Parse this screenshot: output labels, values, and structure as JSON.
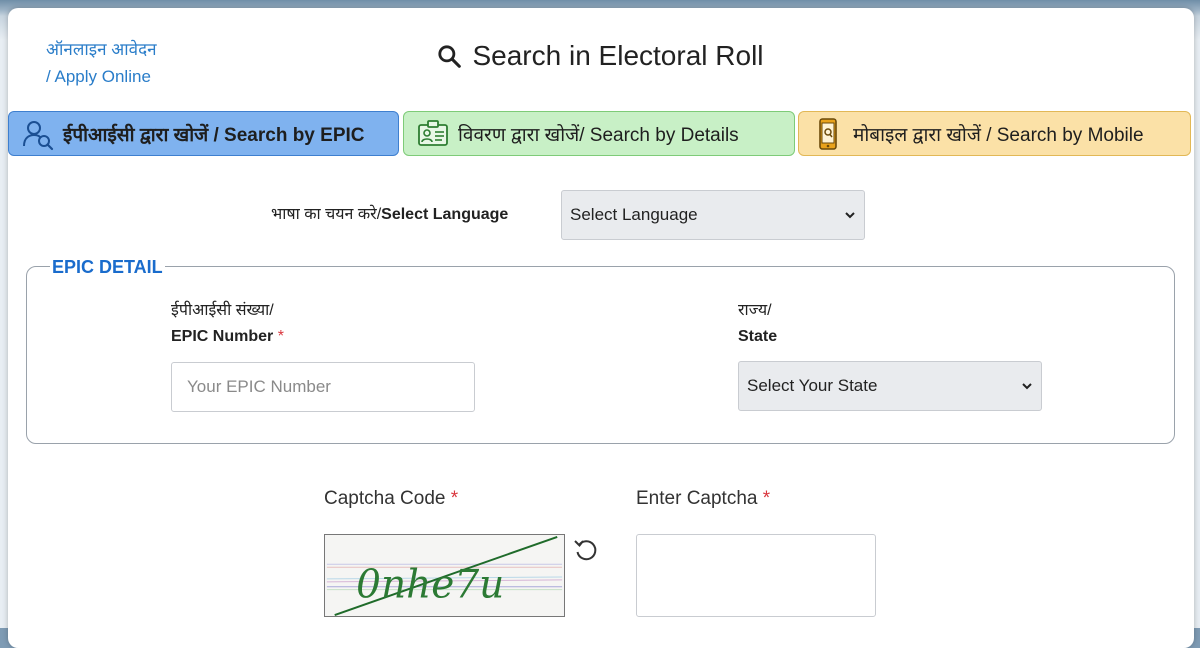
{
  "header": {
    "apply_line1": "ऑनलाइन आवेदन",
    "apply_line2": "/ Apply Online",
    "title": "Search in Electoral Roll"
  },
  "tabs": [
    {
      "label": "ईपीआईसी द्वारा खोजें / Search by EPIC",
      "icon": "user-search-icon",
      "active": true
    },
    {
      "label": "विवरण द्वारा खोजें/ Search by Details",
      "icon": "id-card-icon",
      "active": false
    },
    {
      "label": "मोबाइल द्वारा खोजें / Search by Mobile",
      "icon": "mobile-phone-icon",
      "active": false
    }
  ],
  "language": {
    "label_hindi": "भाषा का चयन करे/",
    "label_english": "Select Language",
    "selected": "Select Language"
  },
  "epic_detail": {
    "legend": "EPIC DETAIL",
    "epic_label_hindi": "ईपीआईसी संख्या/",
    "epic_label_english": "EPIC Number",
    "required_mark": "*",
    "epic_placeholder": "Your EPIC Number",
    "state_label_hindi": "राज्य/",
    "state_label_english": "State",
    "state_selected": "Select Your State"
  },
  "captcha": {
    "code_label": "Captcha Code",
    "enter_label": "Enter Captcha",
    "required_mark": "*",
    "text": "0nhe7u"
  },
  "colors": {
    "tab_epic": "#7fb2ef",
    "tab_details": "#c8f0c6",
    "tab_mobile": "#fbe1a7",
    "link": "#2a7dc9",
    "legend": "#1a6ccc",
    "required": "#d9363e"
  }
}
